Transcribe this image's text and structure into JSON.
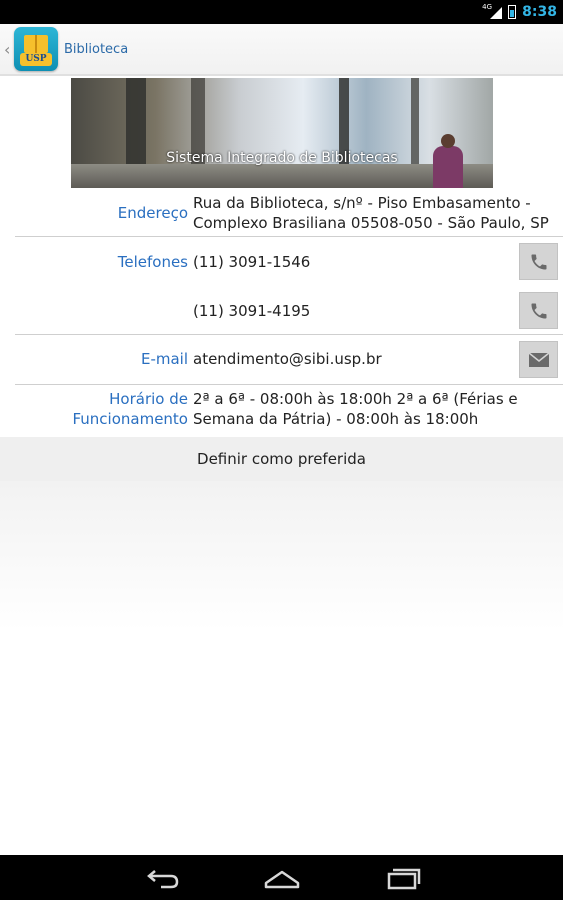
{
  "status_bar": {
    "network": "4G",
    "time": "8:38"
  },
  "action_bar": {
    "title": "Biblioteca",
    "app_icon_badge": "USP"
  },
  "banner": {
    "caption": "Sistema Integrado de Bibliotecas"
  },
  "details": {
    "address": {
      "label": "Endereço",
      "line1": "Rua da Biblioteca, s/nº - Piso Embasamento -",
      "line2": "Complexo Brasiliana 05508-050 - São Paulo, SP"
    },
    "phones": {
      "label": "Telefones",
      "numbers": [
        "(11) 3091-1546",
        "(11) 3091-4195"
      ]
    },
    "email": {
      "label": "E-mail",
      "value": "atendimento@sibi.usp.br"
    },
    "hours": {
      "label_line1": "Horário de",
      "label_line2": "Funcionamento",
      "line1": "2ª a 6ª - 08:00h às 18:00h 2ª a 6ª (Férias e",
      "line2": "Semana da Pátria) - 08:00h às 18:00h"
    }
  },
  "favorite_button": {
    "label": "Definir como preferida"
  },
  "icons": {
    "back": "back-icon",
    "home": "home-icon",
    "recent": "recent-apps-icon",
    "phone": "phone-icon",
    "mail": "mail-icon"
  }
}
